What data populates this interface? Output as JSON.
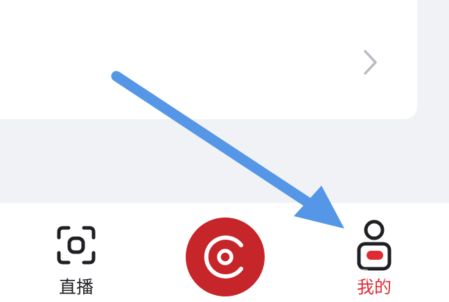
{
  "tabbar": {
    "live_label": "直播",
    "mine_label": "我的"
  },
  "icons": {
    "live": "scan-frame-icon",
    "record": "record-disc-icon",
    "mine": "user-profile-icon",
    "chevron": "chevron-right-icon"
  },
  "colors": {
    "active_tab": "#e02b33",
    "record_button": "#c6252a",
    "annotation_arrow": "#5596e6",
    "page_background": "#f1f2f6"
  }
}
